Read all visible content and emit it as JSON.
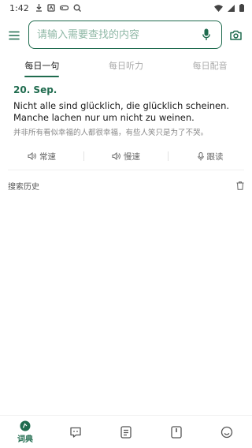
{
  "status_bar": {
    "time": "1:42"
  },
  "search": {
    "placeholder": "请输入需要查找的内容"
  },
  "tabs": [
    {
      "label": "每日一句",
      "active": true
    },
    {
      "label": "每日听力",
      "active": false
    },
    {
      "label": "每日配音",
      "active": false
    }
  ],
  "daily": {
    "date": "20. Sep.",
    "sentence": "Nicht alle sind glücklich, die glücklich scheinen. Manche lachen nur um nicht zu weinen.",
    "translation": "并非所有看似幸福的人都很幸福，有些人笑只是为了不哭。"
  },
  "actions": [
    {
      "label": "常速",
      "icon": "speaker-icon"
    },
    {
      "label": "慢速",
      "icon": "speaker-icon"
    },
    {
      "label": "跟读",
      "icon": "microphone-icon"
    }
  ],
  "history": {
    "title": "搜索历史"
  },
  "bottom_nav": [
    {
      "label": "词典",
      "icon": "dictionary-icon",
      "active": true
    },
    {
      "label": "",
      "icon": "chat-icon",
      "active": false
    },
    {
      "label": "",
      "icon": "notes-icon",
      "active": false
    },
    {
      "label": "",
      "icon": "book-icon",
      "active": false
    },
    {
      "label": "",
      "icon": "smiley-icon",
      "active": false
    }
  ],
  "colors": {
    "accent": "#1f6b4e",
    "muted": "#8a8a8a",
    "placeholder": "#8fb8a6"
  }
}
